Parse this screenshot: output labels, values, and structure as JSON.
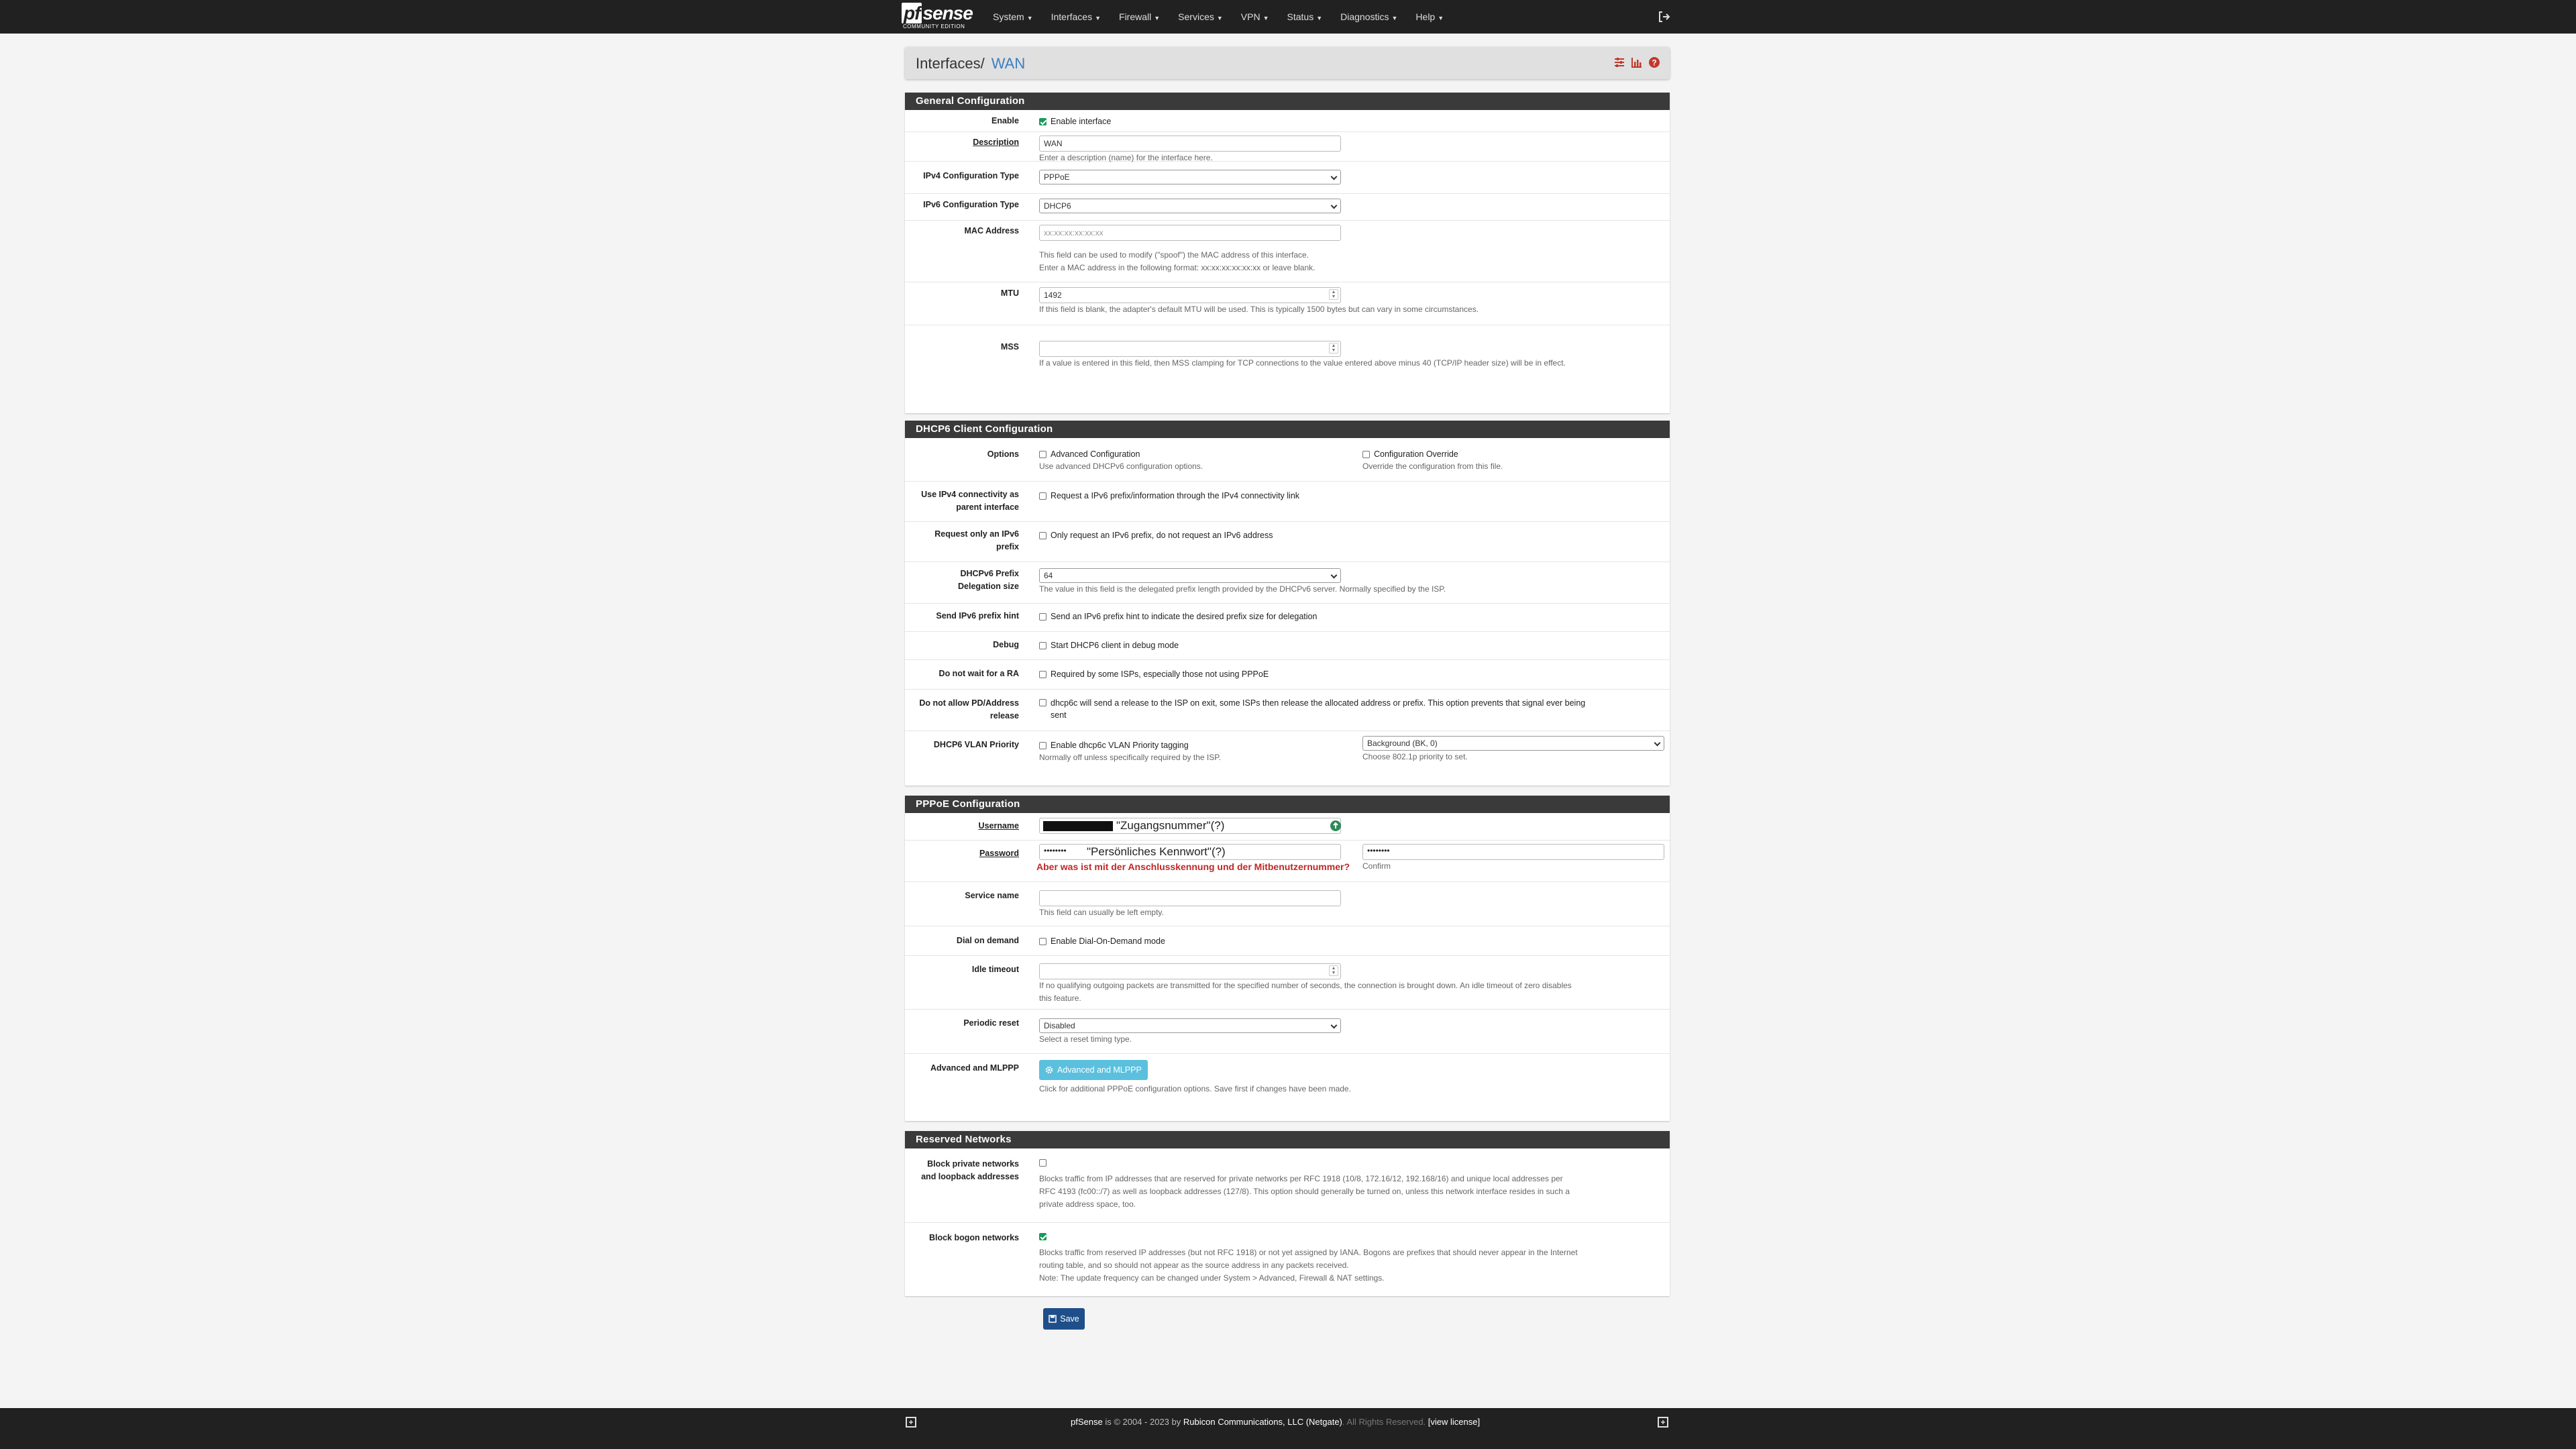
{
  "brand": {
    "name": "sense",
    "prefix": "pf",
    "edition": "COMMUNITY EDITION"
  },
  "nav": [
    "System",
    "Interfaces",
    "Firewall",
    "Services",
    "VPN",
    "Status",
    "Diagnostics",
    "Help"
  ],
  "breadcrumb": {
    "parent": "Interfaces",
    "separator": "/",
    "current": "WAN"
  },
  "colors": {
    "navbar": "#212121",
    "panel_heading": "#3a3a3a",
    "accent": "#3c7ec3",
    "check": "#1a9a5a",
    "info_button": "#5bc0de",
    "save_button": "#1e4f8a",
    "annotation_red": "#c02727"
  },
  "general": {
    "heading": "General Configuration",
    "enable": {
      "label": "Enable",
      "text": "Enable interface",
      "checked": true
    },
    "description": {
      "label": "Description",
      "value": "WAN",
      "help": "Enter a description (name) for the interface here."
    },
    "ipv4_type": {
      "label": "IPv4 Configuration Type",
      "value": "PPPoE"
    },
    "ipv6_type": {
      "label": "IPv6 Configuration Type",
      "value": "DHCP6"
    },
    "mac": {
      "label": "MAC Address",
      "placeholder": "xx:xx:xx:xx:xx:xx",
      "help1": "This field can be used to modify (\"spoof\") the MAC address of this interface.",
      "help2": "Enter a MAC address in the following format: xx:xx:xx:xx:xx:xx or leave blank."
    },
    "mtu": {
      "label": "MTU",
      "value": "1492",
      "help": "If this field is blank, the adapter's default MTU will be used. This is typically 1500 bytes but can vary in some circumstances."
    },
    "mss": {
      "label": "MSS",
      "value": "",
      "help": "If a value is entered in this field, then MSS clamping for TCP connections to the value entered above minus 40 (TCP/IP header size) will be in effect."
    }
  },
  "dhcp6": {
    "heading": "DHCP6 Client Configuration",
    "options": {
      "label": "Options",
      "advanced": "Advanced Configuration",
      "advanced_help": "Use advanced DHCPv6 configuration options.",
      "override": "Configuration Override",
      "override_help": "Override the configuration from this file."
    },
    "ipv4_parent": {
      "label1": "Use IPv4 connectivity as",
      "label2": "parent interface",
      "text": "Request a IPv6 prefix/information through the IPv4 connectivity link"
    },
    "only_prefix": {
      "label1": "Request only an IPv6",
      "label2": "prefix",
      "text": "Only request an IPv6 prefix, do not request an IPv6 address"
    },
    "prefix_size": {
      "label1": "DHCPv6 Prefix",
      "label2": "Delegation size",
      "value": "64",
      "help": "The value in this field is the delegated prefix length provided by the DHCPv6 server. Normally specified by the ISP."
    },
    "prefix_hint": {
      "label": "Send IPv6 prefix hint",
      "text": "Send an IPv6 prefix hint to indicate the desired prefix size for delegation"
    },
    "debug": {
      "label": "Debug",
      "text": "Start DHCP6 client in debug mode"
    },
    "no_ra": {
      "label": "Do not wait for a RA",
      "text": "Required by some ISPs, especially those not using PPPoE"
    },
    "no_release": {
      "label1": "Do not allow PD/Address",
      "label2": "release",
      "text1": "dhcp6c will send a release to the ISP on exit, some ISPs then release the allocated address or prefix. This option prevents that signal ever being",
      "text2": "sent"
    },
    "vlan": {
      "label": "DHCP6 VLAN Priority",
      "text": "Enable dhcp6c VLAN Priority tagging",
      "help": "Normally off unless specifically required by the ISP.",
      "select": "Background (BK, 0)",
      "select_help": "Choose 802.1p priority to set."
    }
  },
  "pppoe": {
    "heading": "PPPoE Configuration",
    "username": {
      "label": "Username",
      "annotation": "\"Zugangsnummer\"(?)"
    },
    "password": {
      "label": "Password",
      "value": "••••••••",
      "annotation": "\"Persönliches Kennwort\"(?)",
      "confirm_value": "••••••••",
      "confirm": "Confirm",
      "question": "Aber was ist mit der Anschlusskennung und der Mitbenutzernummer?"
    },
    "service": {
      "label": "Service name",
      "help": "This field can usually be left empty."
    },
    "dial": {
      "label": "Dial on demand",
      "text": "Enable Dial-On-Demand mode"
    },
    "idle": {
      "label": "Idle timeout",
      "help1": "If no qualifying outgoing packets are transmitted for the specified number of seconds, the connection is brought down. An idle timeout of zero disables",
      "help2": "this feature."
    },
    "reset": {
      "label": "Periodic reset",
      "value": "Disabled",
      "help": "Select a reset timing type."
    },
    "advanced": {
      "label": "Advanced and MLPPP",
      "button": "Advanced and MLPPP",
      "help": "Click for additional PPPoE configuration options. Save first if changes have been made."
    }
  },
  "reserved": {
    "heading": "Reserved Networks",
    "private": {
      "label1": "Block private networks",
      "label2": "and loopback addresses",
      "checked": false,
      "help1": "Blocks traffic from IP addresses that are reserved for private networks per RFC 1918 (10/8, 172.16/12, 192.168/16) and unique local addresses per",
      "help2": "RFC 4193 (fc00::/7) as well as loopback addresses (127/8). This option should generally be turned on, unless this network interface resides in such a",
      "help3": "private address space, too."
    },
    "bogon": {
      "label": "Block bogon networks",
      "checked": true,
      "help1": "Blocks traffic from reserved IP addresses (but not RFC 1918) or not yet assigned by IANA. Bogons are prefixes that should never appear in the Internet",
      "help2": "routing table, and so should not appear as the source address in any packets received.",
      "help3": "Note: The update frequency can be changed under System > Advanced, Firewall & NAT settings."
    }
  },
  "save": "Save",
  "footer": {
    "product": "pfSense",
    "copyright": "is © 2004 - 2023 by",
    "company": "Rubicon Communications, LLC (Netgate)",
    "rights": ". All Rights Reserved.",
    "license": "[view license]"
  }
}
